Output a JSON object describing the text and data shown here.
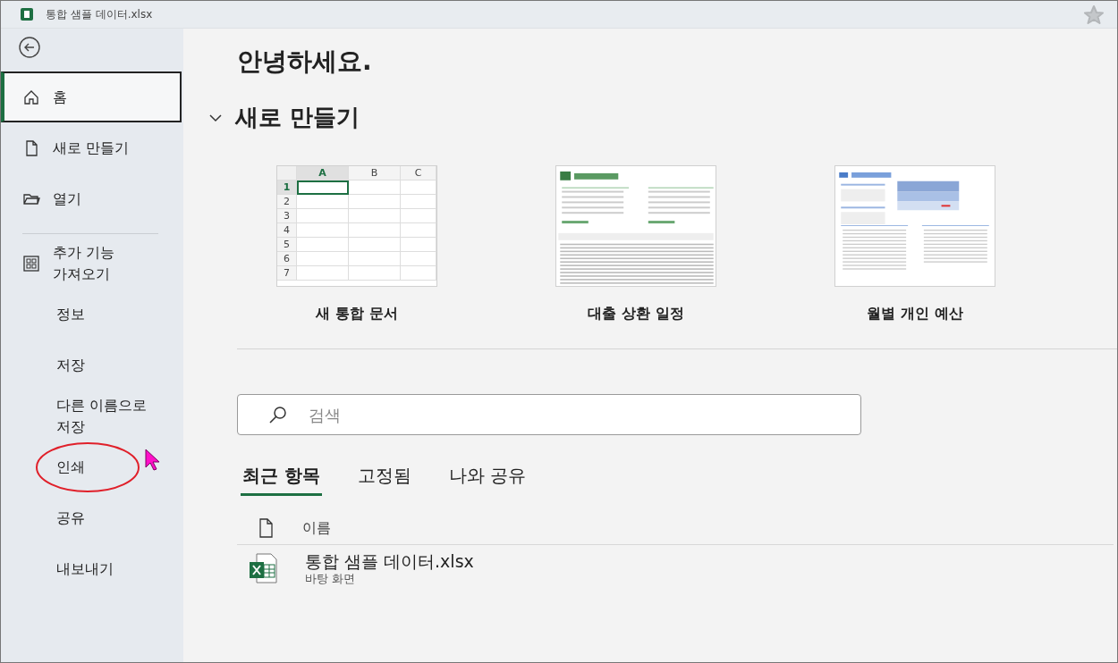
{
  "window": {
    "title": "통합 샘플 데이터.xlsx"
  },
  "sidebar": {
    "items": [
      {
        "label": "홈",
        "kind": "home",
        "selected": true
      },
      {
        "label": "새로 만들기",
        "kind": "new",
        "selected": false
      },
      {
        "label": "열기",
        "kind": "open",
        "selected": false
      },
      {
        "label": "추가 기능 가져오기",
        "kind": "addins",
        "selected": false,
        "divider_before": true
      },
      {
        "label": "정보",
        "selected": false
      },
      {
        "label": "저장",
        "selected": false
      },
      {
        "label": "다른 이름으로 저장",
        "selected": false
      },
      {
        "label": "인쇄",
        "selected": false,
        "annotated": true
      },
      {
        "label": "공유",
        "selected": false
      },
      {
        "label": "내보내기",
        "selected": false
      }
    ]
  },
  "greeting": "안녕하세요.",
  "new_section": {
    "title": "새로 만들기",
    "expanded": true,
    "templates": [
      {
        "kind": "blank",
        "label": "새 통합 문서",
        "columns": [
          "A",
          "B",
          "C"
        ],
        "rows": [
          "1",
          "2",
          "3",
          "4",
          "5",
          "6",
          "7"
        ]
      },
      {
        "kind": "loan",
        "label": "대출 상환 일정"
      },
      {
        "kind": "budget",
        "label": "월별 개인 예산"
      }
    ]
  },
  "search": {
    "placeholder": "검색"
  },
  "tabs": [
    {
      "label": "최근 항목",
      "selected": true
    },
    {
      "label": "고정됨",
      "selected": false
    },
    {
      "label": "나와 공유",
      "selected": false
    }
  ],
  "files": {
    "header": "이름",
    "rows": [
      {
        "name": "통합 샘플 데이터.xlsx",
        "location": "바탕 화면"
      }
    ]
  }
}
